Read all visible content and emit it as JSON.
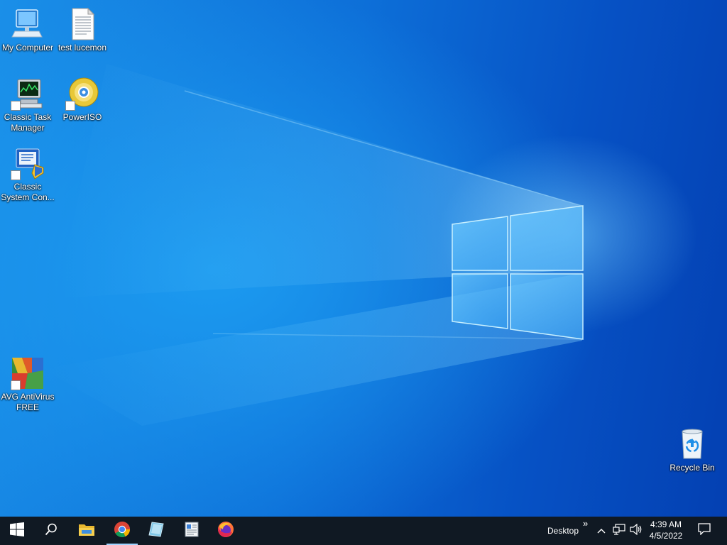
{
  "desktop": {
    "icons": [
      {
        "label": "My Computer",
        "icon": "computer-icon"
      },
      {
        "label": "test lucemon",
        "icon": "text-document-icon"
      },
      {
        "label": "Classic Task Manager",
        "icon": "task-manager-icon"
      },
      {
        "label": "PowerISO",
        "icon": "poweriso-disc-icon"
      },
      {
        "label": "Classic System Con...",
        "icon": "system-configuration-icon"
      },
      {
        "label": "AVG AntiVirus FREE",
        "icon": "avg-antivirus-icon"
      },
      {
        "label": "Recycle Bin",
        "icon": "recycle-bin-icon"
      }
    ]
  },
  "taskbar": {
    "pinned": [
      {
        "name": "start-button",
        "icon": "windows-logo-icon"
      },
      {
        "name": "search-button",
        "icon": "search-icon"
      },
      {
        "name": "file-explorer-button",
        "icon": "folder-icon"
      },
      {
        "name": "chrome-button",
        "icon": "chrome-icon",
        "active": true
      },
      {
        "name": "notepad-button",
        "icon": "notepad-icon"
      },
      {
        "name": "wordpad-button",
        "icon": "wordpad-icon"
      },
      {
        "name": "firefox-button",
        "icon": "firefox-icon"
      }
    ],
    "toolbar_label": "Desktop",
    "toolbar_more": "»",
    "tray": {
      "time": "4:39 AM",
      "date": "4/5/2022"
    }
  },
  "colors": {
    "taskbar": "#101923",
    "wallpaper_dark": "#0440b2",
    "wallpaper_light": "#1c9bf0"
  }
}
